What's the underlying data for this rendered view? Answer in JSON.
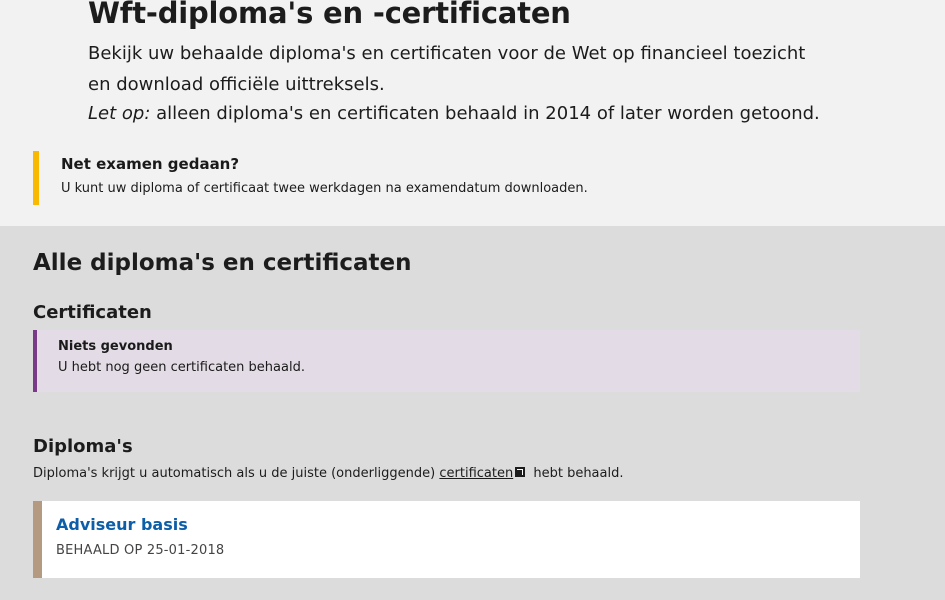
{
  "intro": {
    "title": "Wft-diploma's en -certificaten",
    "lead": "Bekijk uw behaalde diploma's en certificaten voor de Wet op financieel toezicht en download officiële uittreksels.",
    "note_prefix": "Let op:",
    "note_text": " alleen diploma's en certificaten behaald in 2014 of later worden getoond."
  },
  "exam_alert": {
    "title": "Net examen gedaan?",
    "text": "U kunt uw diploma of certificaat twee werkdagen na examendatum downloaden.",
    "accent_color": "#f9b900"
  },
  "all": {
    "title": "Alle diploma's en certificaten"
  },
  "certificates": {
    "title": "Certificaten",
    "empty_title": "Niets gevonden",
    "empty_text": "U hebt nog geen certificaten behaald.",
    "accent_color": "#7a3a8a"
  },
  "diplomas": {
    "title": "Diploma's",
    "text_before": "Diploma's krijgt u automatisch als u de juiste (onderliggende) ",
    "link_text": "certificaten",
    "text_after": " hebt behaald.",
    "items": [
      {
        "name": "Adviseur basis",
        "date": "BEHAALD OP 25-01-2018"
      }
    ]
  }
}
